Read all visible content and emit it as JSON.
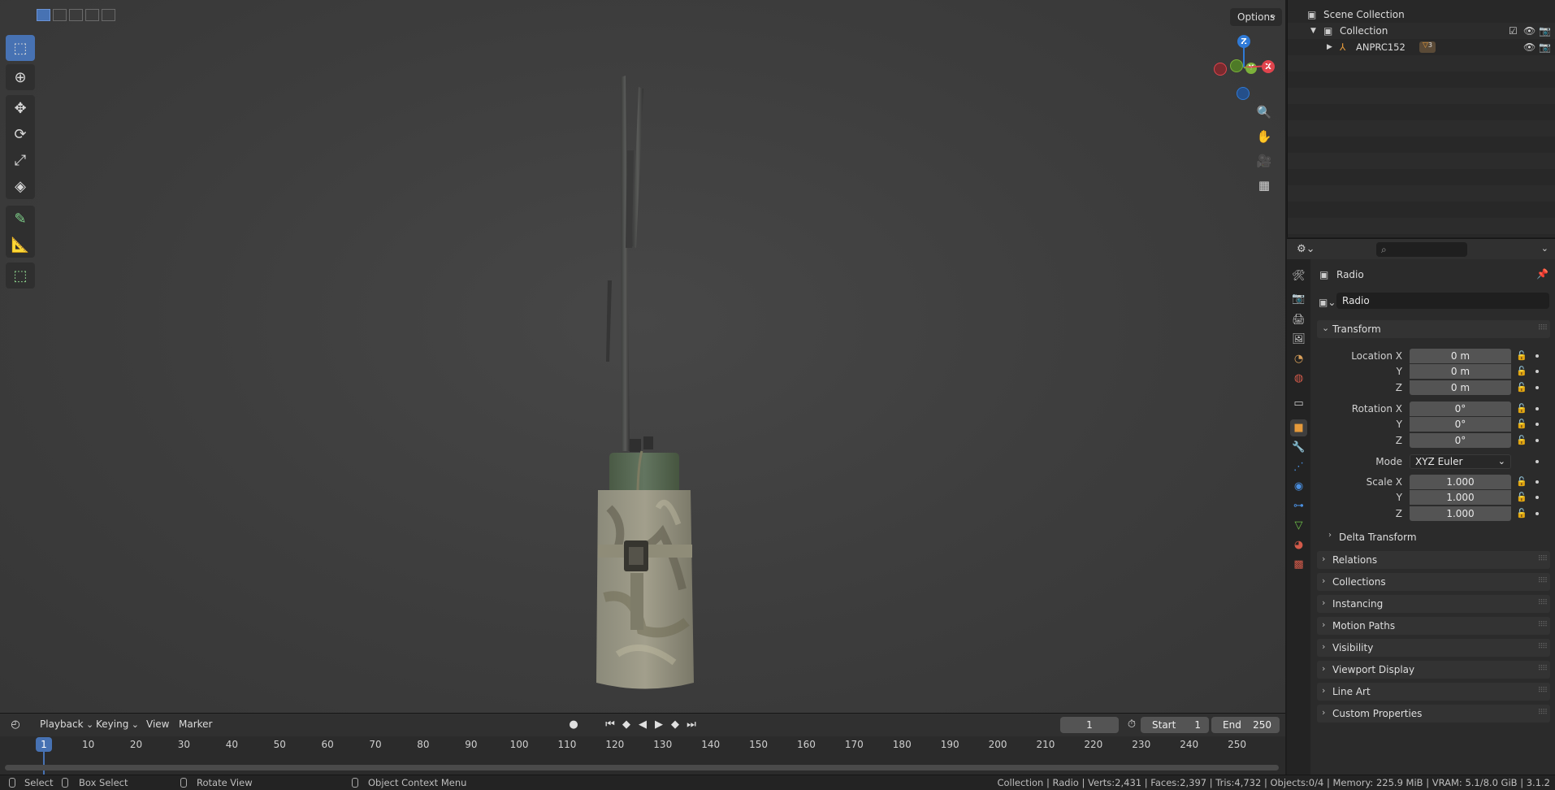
{
  "viewport": {
    "options_label": "Options"
  },
  "gizmo": {
    "z": "Z",
    "y": "Y",
    "x": "X"
  },
  "timeline": {
    "menu": {
      "playback": "Playback",
      "keying": "Keying",
      "view": "View",
      "marker": "Marker"
    },
    "current_frame": "1",
    "start_label": "Start",
    "start_value": "1",
    "end_label": "End",
    "end_value": "250",
    "ticks": [
      "10",
      "20",
      "30",
      "40",
      "50",
      "60",
      "70",
      "80",
      "90",
      "100",
      "110",
      "120",
      "130",
      "140",
      "150",
      "160",
      "170",
      "180",
      "190",
      "200",
      "210",
      "220",
      "230",
      "240",
      "250"
    ],
    "playhead": "1"
  },
  "statusbar": {
    "select": "Select",
    "box_select": "Box Select",
    "rotate_view": "Rotate View",
    "context_menu": "Object Context Menu",
    "stats": "Collection | Radio | Verts:2,431 | Faces:2,397 | Tris:4,732 | Objects:0/4 | Memory: 225.9 MiB | VRAM: 5.1/8.0 GiB | 3.1.2"
  },
  "outliner": {
    "scene_collection": "Scene Collection",
    "collection": "Collection",
    "object": "ANPRC152",
    "object_badge": "3"
  },
  "properties": {
    "header_object": "Radio",
    "object_name": "Radio",
    "transform_title": "Transform",
    "location_label": "Location X",
    "rotation_label": "Rotation X",
    "scale_label": "Scale X",
    "y_label": "Y",
    "z_label": "Z",
    "mode_label": "Mode",
    "location": [
      "0 m",
      "0 m",
      "0 m"
    ],
    "rotation": [
      "0°",
      "0°",
      "0°"
    ],
    "mode_value": "XYZ Euler",
    "scale": [
      "1.000",
      "1.000",
      "1.000"
    ],
    "delta_transform": "Delta Transform",
    "panels": [
      "Relations",
      "Collections",
      "Instancing",
      "Motion Paths",
      "Visibility",
      "Viewport Display",
      "Line Art",
      "Custom Properties"
    ]
  },
  "colors": {
    "accent": "#4772b3",
    "axis_x": "#e0444d",
    "axis_y": "#7cb13a",
    "axis_z": "#2f7ad6"
  }
}
